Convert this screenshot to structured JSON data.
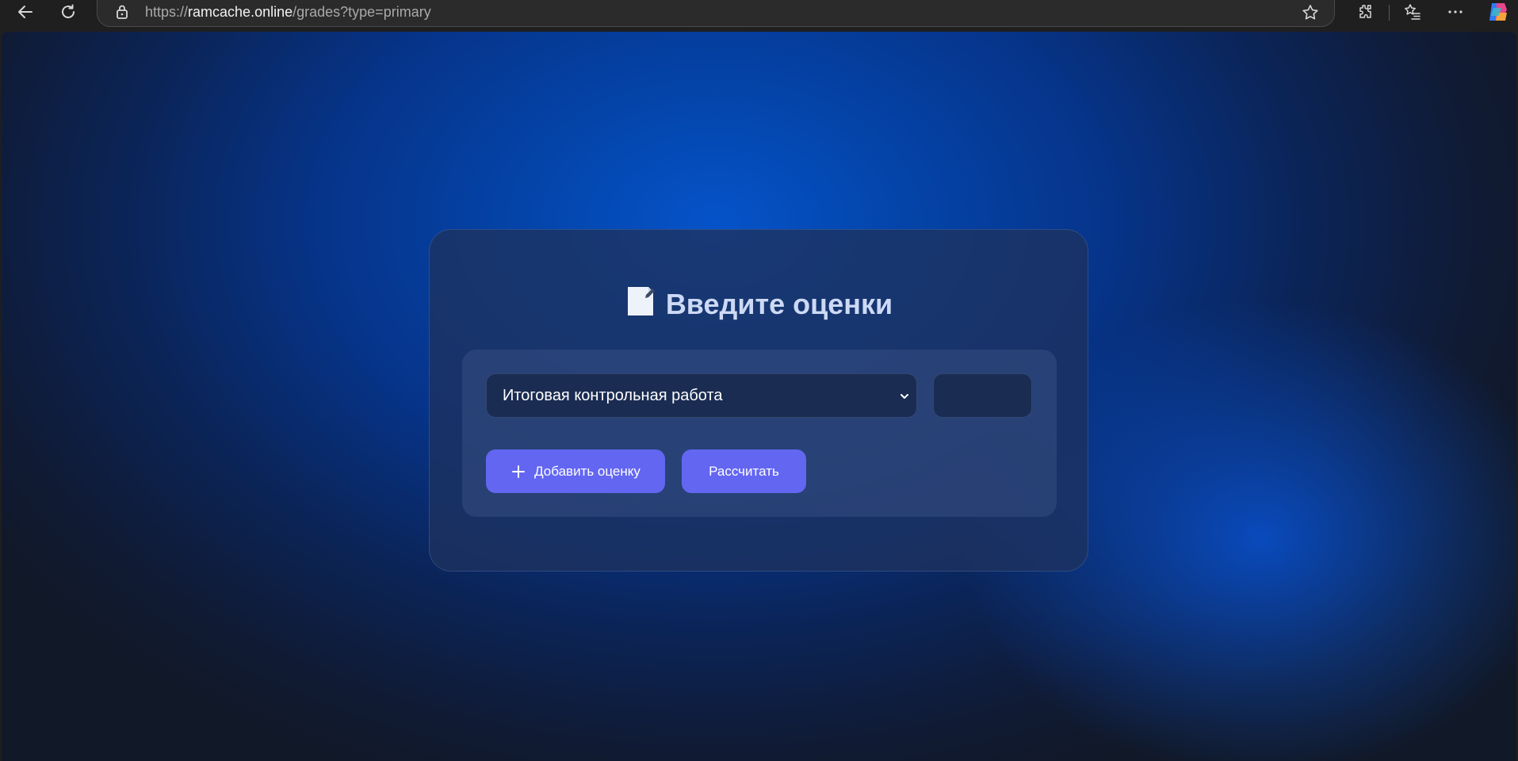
{
  "browser": {
    "url_prefix": "https://",
    "url_host": "ramcache.online",
    "url_path": "/grades?type=primary",
    "icons": {
      "back": "back-arrow-icon",
      "reload": "reload-icon",
      "lock": "lock-icon",
      "favorite": "star-icon",
      "extensions": "puzzle-icon",
      "favorites_list": "favorites-icon",
      "more": "more-dots-icon",
      "copilot": "copilot-icon"
    }
  },
  "page": {
    "title_icon": "memo-icon",
    "title": "Введите оценки",
    "select": {
      "selected": "Итоговая контрольная работа"
    },
    "grade_input": {
      "value": "",
      "placeholder": ""
    },
    "add_button": {
      "label": "Добавить оценку",
      "icon": "plus-icon"
    },
    "calc_button": {
      "label": "Рассчитать"
    }
  },
  "colors": {
    "accent": "#6366f1",
    "card": "#1e325f",
    "background": "#0553c9"
  }
}
